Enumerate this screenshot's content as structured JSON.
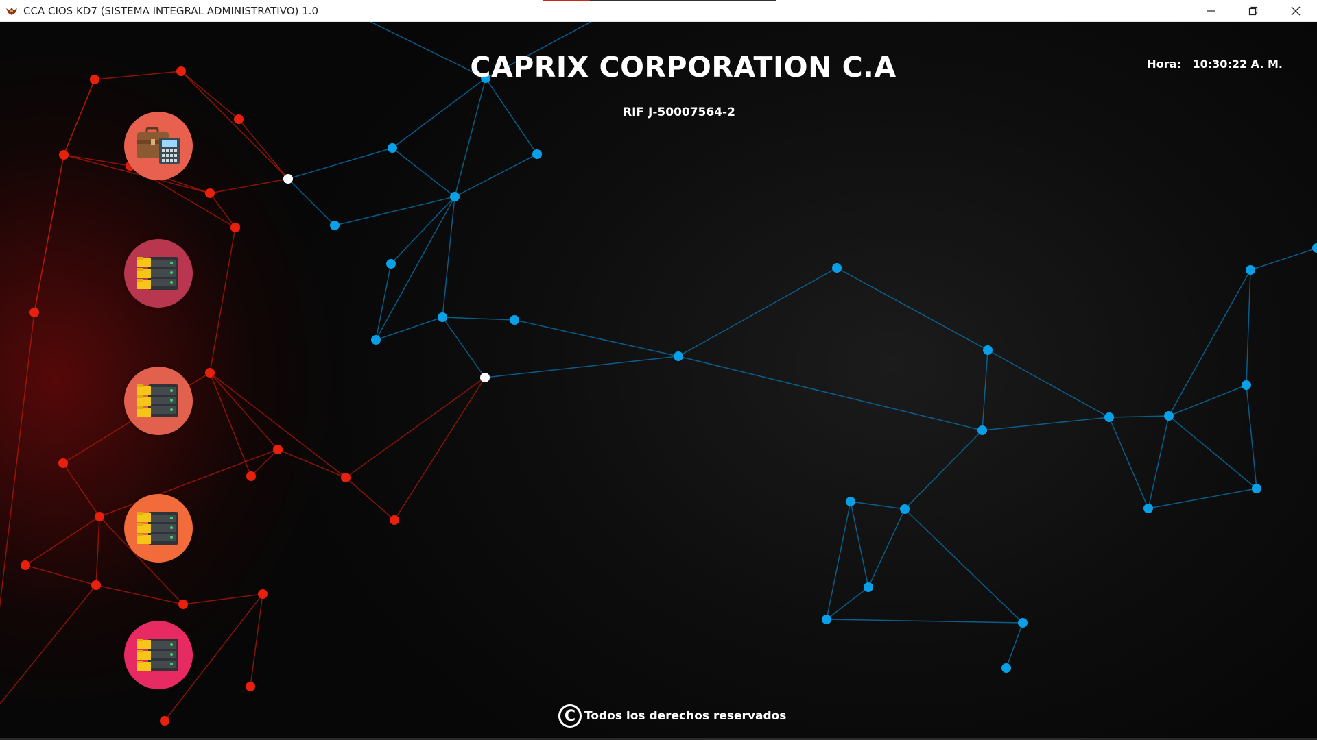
{
  "window": {
    "title": "CCA CIOS KD7 (SISTEMA INTEGRAL ADMINISTRATIVO) 1.0",
    "app_icon": "eagle-icon",
    "controls": {
      "minimize": "minimize-icon",
      "maximize": "restore-icon",
      "close": "close-icon"
    }
  },
  "header": {
    "company": "CAPRIX CORPORATION C.A",
    "rif": "RIF J-50007564-2",
    "clock_label": "Hora:",
    "clock_value": "10:30:22 A. M."
  },
  "menu": [
    {
      "icon": "briefcase-calculator-icon",
      "color": "#e8614f"
    },
    {
      "icon": "server-folder-icon",
      "color": "#b8374f"
    },
    {
      "icon": "server-folder-icon",
      "color": "#e2604e"
    },
    {
      "icon": "server-folder-icon",
      "color": "#f26b3a"
    },
    {
      "icon": "server-folder-icon",
      "color": "#e82a63"
    }
  ],
  "footer": {
    "copyright_symbol": "C",
    "text": "Todos los derechos reservados"
  },
  "colors": {
    "blue_node": "#0aa0e8",
    "red_node": "#e8200e",
    "white_node": "#ffffff"
  }
}
